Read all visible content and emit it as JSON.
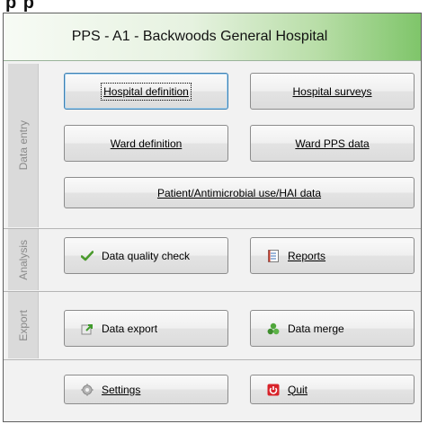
{
  "header_fragment": "p p",
  "app": {
    "title": "PPS - A1 - Backwoods General Hospital"
  },
  "sections": {
    "data_entry": "Data entry",
    "analysis": "Analysis",
    "export": "Export"
  },
  "buttons": {
    "hospital_definition": "Hospital definition",
    "hospital_surveys": "Hospital surveys",
    "ward_definition": "Ward definition",
    "ward_pps_data": "Ward PPS data",
    "patient_data": "Patient/Antimicrobial use/HAI data",
    "data_quality_check": "Data quality check",
    "reports": "Reports",
    "data_export": "Data export",
    "data_merge": "Data merge",
    "settings": "Settings",
    "quit": "Quit"
  },
  "icons": {
    "data_quality_check": "checkmark-icon",
    "reports": "report-icon",
    "data_export": "export-icon",
    "data_merge": "merge-icon",
    "settings": "gear-icon",
    "quit": "power-icon"
  },
  "colors": {
    "title_gradient_end": "#7fc56a",
    "accent_green": "#4a9a2c",
    "quit_red": "#d8232a",
    "tab_gray": "#dadada"
  }
}
